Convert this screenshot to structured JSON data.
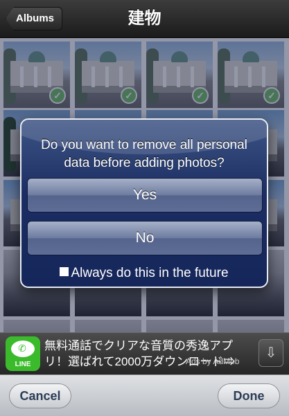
{
  "nav": {
    "back_label": "Albums",
    "title": "建物"
  },
  "grid": {
    "selected_count": 4,
    "check_glyph": "✓"
  },
  "alert": {
    "message_line1": "Do you want to remove all personal",
    "message_line2": "data before adding photos?",
    "yes_label": "Yes",
    "no_label": "No",
    "option_label": "Always do this in the future",
    "option_checked": false
  },
  "ad": {
    "app_icon_label": "LINE",
    "text_line1": "無料通話でクリアな音質の秀逸アプ",
    "text_line2": "リ！選ばれて2000万ダウンロード⇒",
    "attribution": "Ads by AdMob",
    "icon_name": "download-icon"
  },
  "toolbar": {
    "cancel_label": "Cancel",
    "done_label": "Done"
  },
  "colors": {
    "alert_bg": "#1b2d63",
    "check_green": "#4cae3c",
    "line_green": "#3bbb2c",
    "toolbar_text": "#2c3d57"
  }
}
